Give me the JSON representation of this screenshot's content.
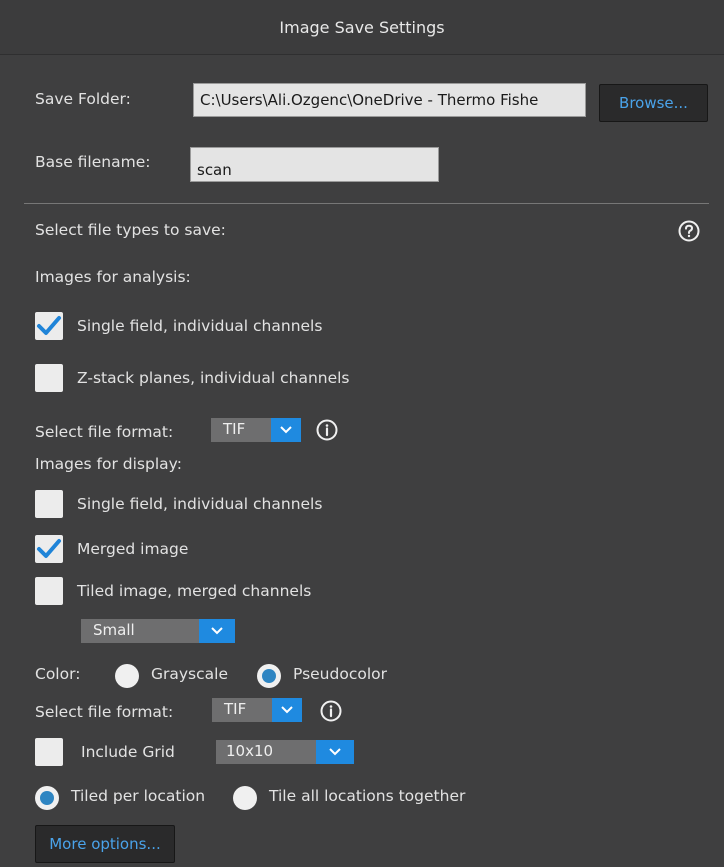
{
  "window": {
    "title": "Image Save Settings"
  },
  "save_folder": {
    "label": "Save Folder:",
    "value": "C:\\Users\\Ali.Ozgenc\\OneDrive - Thermo Fishe",
    "browse_label": "Browse..."
  },
  "base_filename": {
    "label": "Base filename:",
    "value": "scan"
  },
  "file_types": {
    "label": "Select file types to save:",
    "help_icon": "question-circle-icon"
  },
  "analysis": {
    "heading": "Images for analysis:",
    "single_field": {
      "label": "Single field, individual channels",
      "checked": true
    },
    "zstack": {
      "label": "Z-stack planes, individual channels",
      "checked": false
    },
    "format_label": "Select file format:",
    "format_value": "TIF",
    "info_icon": "info-circle-icon"
  },
  "display": {
    "heading": "Images for display:",
    "single_field": {
      "label": "Single field, individual channels",
      "checked": false
    },
    "merged": {
      "label": "Merged image",
      "checked": true
    },
    "tiled": {
      "label": "Tiled image, merged channels",
      "checked": false
    },
    "tile_size": "Small",
    "color_label": "Color:",
    "grayscale_label": "Grayscale",
    "pseudocolor_label": "Pseudocolor",
    "color_selected": "Pseudocolor",
    "format_label": "Select file format:",
    "format_value": "TIF",
    "include_grid_label": "Include Grid",
    "include_grid_checked": false,
    "grid_value": "10x10",
    "tiled_per_location_label": "Tiled per location",
    "tile_all_label": "Tile all locations together",
    "tiling_selected": "Tiled per location"
  },
  "more_options_label": "More options...",
  "colors": {
    "accent": "#1f8ae0",
    "background": "#3f3f40",
    "link": "#4aa3ea"
  }
}
